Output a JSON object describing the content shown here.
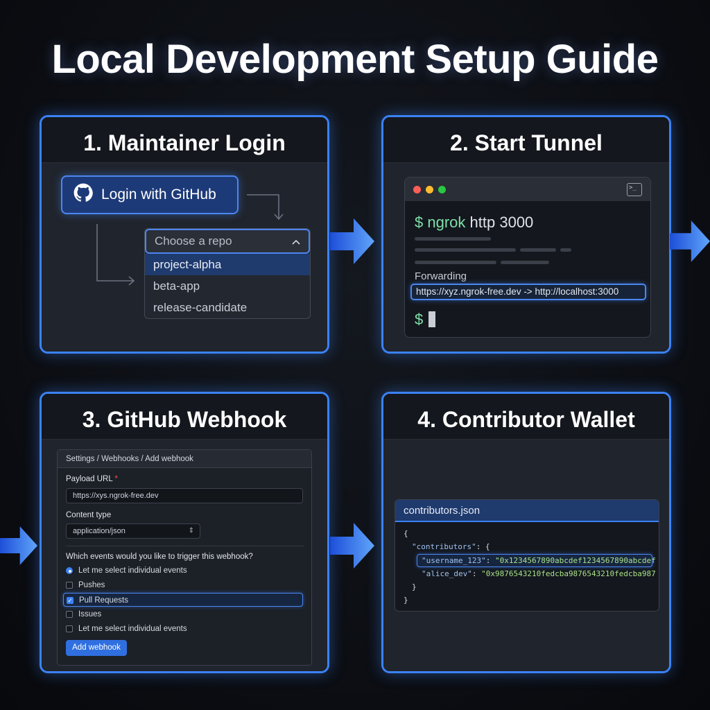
{
  "title": "Local Development Setup Guide",
  "accent_color": "#3b82f6",
  "panels": {
    "login": {
      "heading": "1. Maintainer Login",
      "github_button": "Login with GitHub",
      "github_icon": "github-icon",
      "repo_select": {
        "placeholder": "Choose a repo",
        "options": [
          "project-alpha",
          "beta-app",
          "release-candidate"
        ],
        "highlighted": "project-alpha"
      }
    },
    "tunnel": {
      "heading": "2. Start Tunnel",
      "prompt_symbol": "$",
      "command_tool": "ngrok",
      "command_args": "http 3000",
      "forwarding_label": "Forwarding",
      "forwarding_url": "https://xyz.ngrok-free.dev -> http://localhost:3000",
      "terminal_icon": ">_",
      "window_dot_colors": [
        "#ff5f57",
        "#febc2e",
        "#28c840"
      ]
    },
    "webhook": {
      "heading": "3. GitHub Webhook",
      "breadcrumb": "Settings / Webhooks / Add webhook",
      "payload_url_label": "Payload URL",
      "required_marker": "*",
      "payload_url_value": "https://xys.ngrok-free.dev",
      "content_type_label": "Content type",
      "content_type_value": "application/json",
      "events_question": "Which events would you like to trigger this webhook?",
      "events": [
        {
          "label": "Let me select individual events",
          "kind": "radio",
          "checked": true
        },
        {
          "label": "Pushes",
          "kind": "checkbox",
          "checked": false
        },
        {
          "label": "Pull Requests",
          "kind": "checkbox",
          "checked": true
        },
        {
          "label": "Issues",
          "kind": "checkbox",
          "checked": false
        },
        {
          "label": "Let me select individual events",
          "kind": "checkbox",
          "checked": false
        }
      ],
      "submit_button": "Add webhook"
    },
    "wallet": {
      "heading": "4. Contributor Wallet",
      "file_name": "contributors.json",
      "json_lines": {
        "open": "{",
        "contributors_key": "\"contributors\"",
        "contributors_open": ": {",
        "entry1_key": "\"username_123\"",
        "entry1_value": "\"0x1234567890abcdef1234567890abcdef",
        "entry2_key": "\"alice_dev\"",
        "entry2_value": "\"0x9876543210fedcba9876543210fedcba987",
        "inner_close": "}",
        "close": "}"
      }
    }
  }
}
